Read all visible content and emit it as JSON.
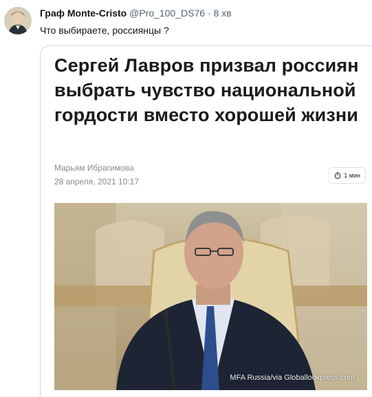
{
  "tweet": {
    "author_name": "Граф Monte-Cristo",
    "author_handle": "@Pro_100_DS76",
    "separator": "·",
    "time": "8 хв",
    "text": "Что выбираете, россиянцы ?"
  },
  "article": {
    "headline": "Сергей Лавров призвал россиян выбрать чувство национальной гордости вместо хорошей жизни",
    "author": "Марьям Ибрагимова",
    "date": "28 апреля, 2021 10:17",
    "read_time": "1 мин",
    "photo_credit": "MFA Russia/via Globallookpress.com"
  },
  "icons": {
    "avatar": "portrait-avatar",
    "read_time_icon": "stopwatch-icon"
  },
  "colors": {
    "text_primary": "#0f1419",
    "text_secondary": "#536471",
    "border": "#cfd9de"
  }
}
